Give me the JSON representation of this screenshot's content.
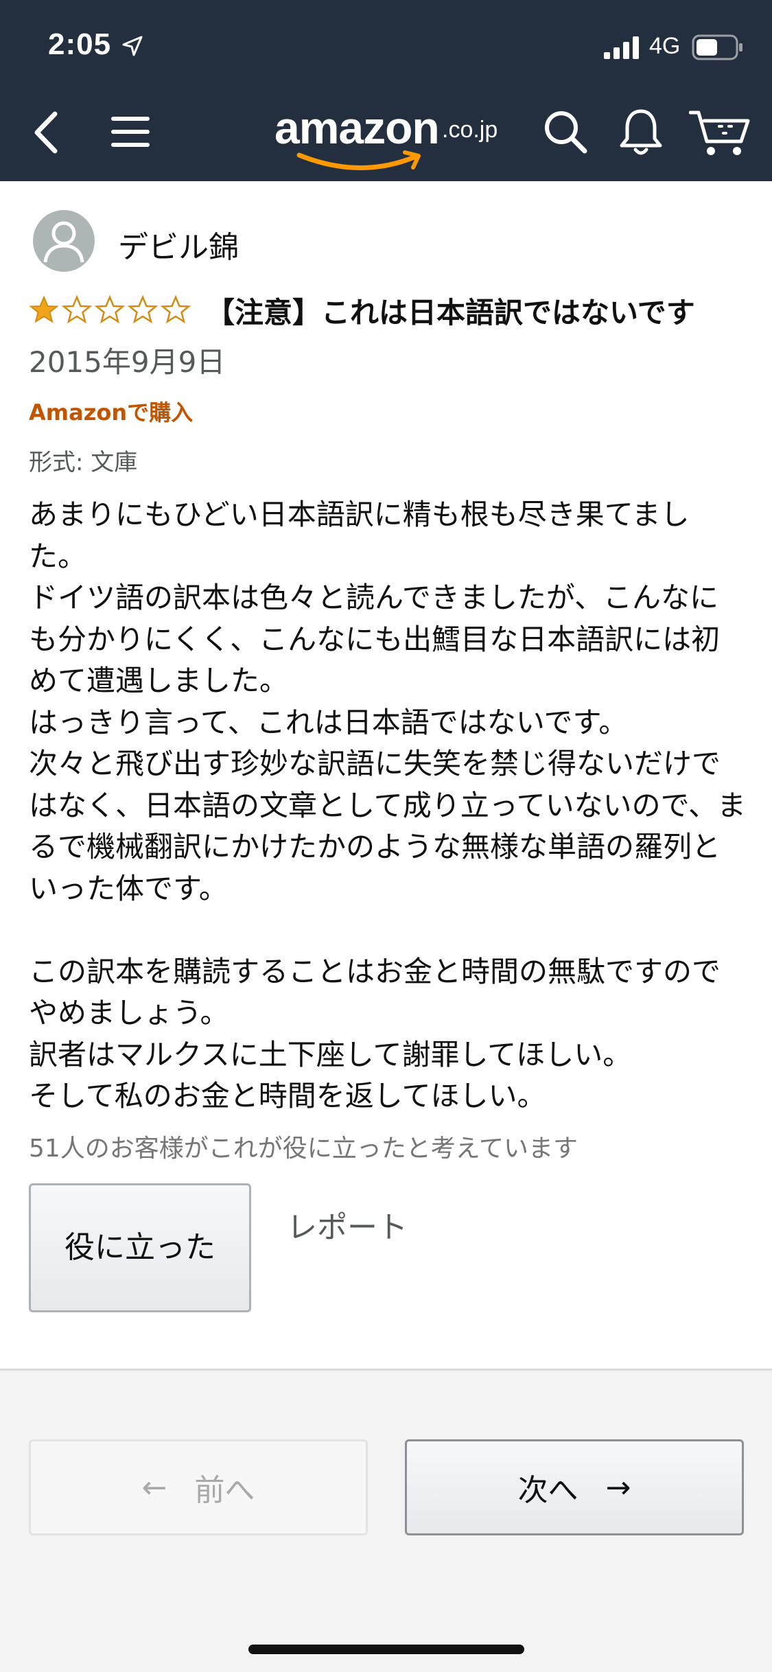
{
  "status_bar": {
    "time": "2:05",
    "network": "4G"
  },
  "header": {
    "logo_text": "amazon",
    "logo_tld": ".co.jp",
    "icons": [
      "back-icon",
      "menu-icon",
      "search-icon",
      "bell-icon",
      "cart-icon"
    ],
    "background_color": "#232f3e",
    "accent_color": "#ff9900"
  },
  "review": {
    "reviewer_name": "デビル錦",
    "rating": 1,
    "max_rating": 5,
    "title": "【注意】これは日本語訳ではないです",
    "date": "2015年9月9日",
    "verified_label": "Amazonで購入",
    "format": "形式: 文庫",
    "body_paragraphs": [
      "あまりにもひどい日本語訳に精も根も尽き果てました。",
      "ドイツ語の訳本は色々と読んできましたが、こんなにも分かりにくく、こんなにも出鱈目な日本語訳には初めて遭遇しました。",
      "はっきり言って、これは日本語ではないです。",
      "次々と飛び出す珍妙な訳語に失笑を禁じ得ないだけではなく、日本語の文章として成り立っていないので、まるで機械翻訳にかけたかのような無様な単語の羅列といった体です。",
      "",
      "この訳本を購読することはお金と時間の無駄ですのでやめましょう。",
      "訳者はマルクスに土下座して謝罪してほしい。",
      "そして私のお金と時間を返してほしい。"
    ],
    "helpful_count": "51人のお客様がこれが役に立ったと考えています",
    "helpful_button": "役に立った",
    "report_link": "レポート"
  },
  "pagination": {
    "prev_label": "前へ",
    "next_label": "次へ"
  }
}
